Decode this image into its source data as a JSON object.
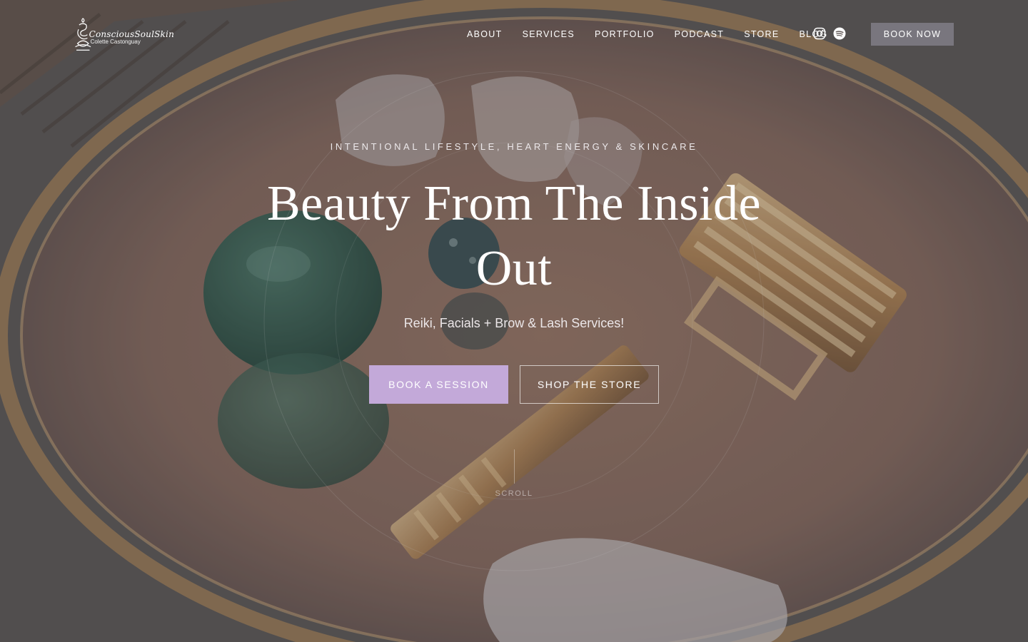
{
  "brand": {
    "name": "ConsciousSoulSkin",
    "tagline": "Colette Castonguay",
    "logo_icon": "lotus-om-logo"
  },
  "nav": {
    "items": [
      {
        "label": "ABOUT"
      },
      {
        "label": "SERVICES"
      },
      {
        "label": "PORTFOLIO"
      },
      {
        "label": "PODCAST"
      },
      {
        "label": "STORE"
      },
      {
        "label": "BLOG"
      }
    ],
    "social": [
      {
        "icon": "instagram-icon"
      },
      {
        "icon": "spotify-icon"
      }
    ],
    "book_now_label": "BOOK NOW"
  },
  "hero": {
    "kicker": "INTENTIONAL LIFESTYLE, HEART ENERGY & SKINCARE",
    "headline": "Beauty From The Inside Out",
    "subhead": "Reiki, Facials + Brow & Lash Services!",
    "primary_cta": "BOOK A SESSION",
    "secondary_cta": "SHOP THE STORE",
    "scroll_label": "SCROLL"
  },
  "colors": {
    "primary_cta_bg": "#c3a9d9",
    "book_now_bg": "#7d7a82",
    "text": "#ffffff"
  }
}
